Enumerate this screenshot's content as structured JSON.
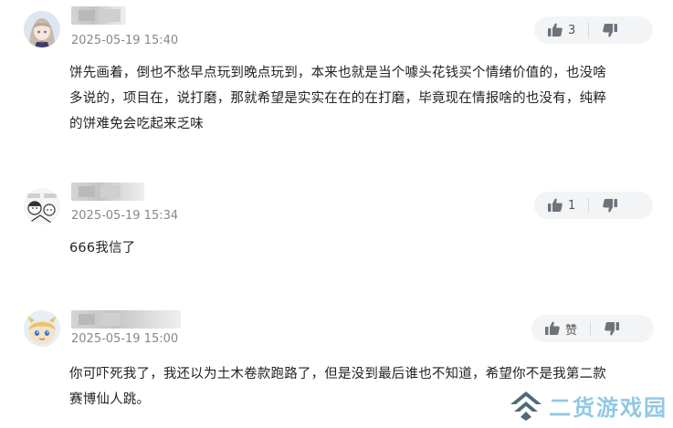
{
  "comments": [
    {
      "avatar": "anime-girl-avatar",
      "timestamp": "2025-05-19 15:40",
      "text_lines": [
        "饼先画着，倒也不愁早点玩到晚点玩到，本来也就是当个噱头花钱买个情绪价值的，也没啥",
        "多说的，项目在，说打磨，那就希望是实实在在的在打磨，毕竟现在情报啥的也没有，纯粹",
        "的饼难免会吃起来乏味"
      ],
      "likes": "3"
    },
    {
      "avatar": "comic-sketch-avatar",
      "timestamp": "2025-05-19 15:34",
      "text_lines": [
        "666我信了"
      ],
      "likes": "1"
    },
    {
      "avatar": "chibi-character-avatar",
      "timestamp": "2025-05-19 15:00",
      "text_lines": [
        "你可吓死我了，我还以为土木卷款跑路了，但是没到最后谁也不知道，希望你不是我第二款",
        "赛博仙人跳。"
      ],
      "likes": "赞"
    }
  ],
  "watermark": {
    "text": "二货游戏园"
  },
  "colors": {
    "accent": "#7fbfe0",
    "muted": "#888888",
    "vote_bg": "#f3f4f6"
  }
}
